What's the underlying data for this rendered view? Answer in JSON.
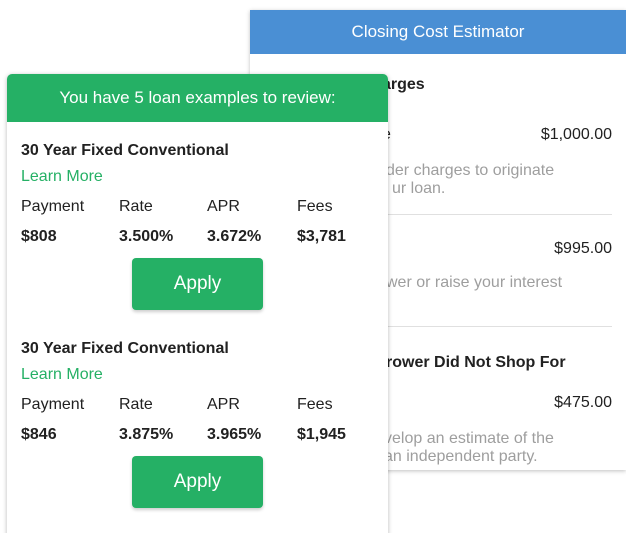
{
  "estimator": {
    "title": "Closing Cost Estimator",
    "section_heading": "arges",
    "items": [
      {
        "name": "e",
        "amount": "$1,000.00",
        "desc_line1": "der charges to originate",
        "desc_line2": "ur loan."
      },
      {
        "name": "",
        "amount": "$995.00",
        "desc_line1": "wer or raise your interest",
        "desc_line2": ""
      }
    ],
    "section2_heading": "rower Did Not Shop For",
    "item3": {
      "amount": "$475.00",
      "desc_line1": "velop an estimate of the",
      "desc_line2": "an independent party."
    }
  },
  "loans_panel": {
    "header": "You have 5 loan examples to review:",
    "columns": {
      "payment": "Payment",
      "rate": "Rate",
      "apr": "APR",
      "fees": "Fees"
    },
    "learn_more_label": "Learn More",
    "apply_label": "Apply",
    "loans": [
      {
        "title": "30 Year Fixed Conventional",
        "payment": "$808",
        "rate": "3.500%",
        "apr": "3.672%",
        "fees": "$3,781"
      },
      {
        "title": "30 Year Fixed Conventional",
        "payment": "$846",
        "rate": "3.875%",
        "apr": "3.965%",
        "fees": "$1,945"
      }
    ]
  },
  "colors": {
    "green": "#25b065",
    "blue": "#4a8fd4"
  }
}
